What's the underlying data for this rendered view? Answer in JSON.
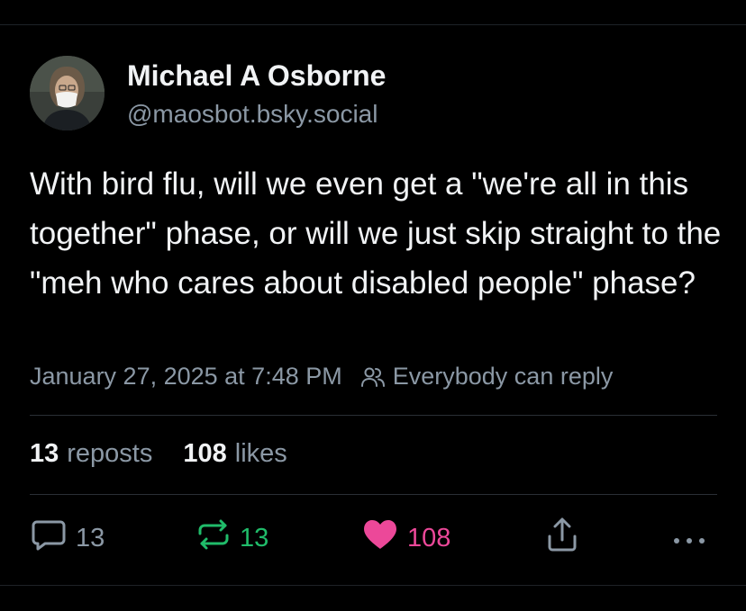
{
  "author": {
    "display_name": "Michael A Osborne",
    "handle": "@maosbot.bsky.social"
  },
  "post": {
    "text": "With bird flu, will we even get a \"we're all in this together\" phase, or will we just skip straight to the \"meh who cares about disabled people\" phase?",
    "timestamp": "January 27, 2025 at 7:48 PM",
    "reply_setting": "Everybody can reply"
  },
  "stats": {
    "reposts_count": "13",
    "reposts_label": "reposts",
    "likes_count": "108",
    "likes_label": "likes"
  },
  "actions": {
    "reply_count": "13",
    "repost_count": "13",
    "like_count": "108"
  },
  "icons": {
    "avatar": "profile-photo",
    "reply_setting": "people-icon",
    "reply": "speech-bubble-icon",
    "repost": "repost-arrows-icon",
    "like": "heart-icon",
    "share": "share-upload-icon",
    "more": "ellipsis-icon"
  },
  "colors": {
    "background": "#000000",
    "muted_text": "#8b98a5",
    "repost_active": "#20bc6a",
    "like_active": "#ec4899"
  }
}
